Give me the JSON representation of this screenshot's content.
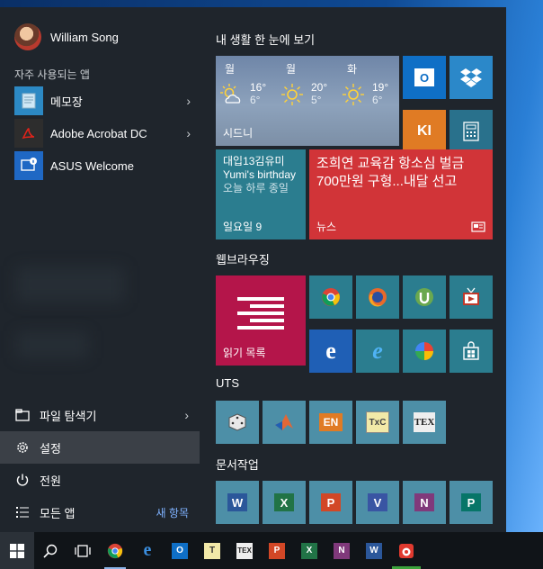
{
  "user": {
    "name": "William Song"
  },
  "frequent": {
    "label": "자주 사용되는 앱",
    "items": [
      {
        "label": "메모장",
        "has_chevron": true
      },
      {
        "label": "Adobe Acrobat DC",
        "has_chevron": true
      },
      {
        "label": "ASUS Welcome",
        "has_chevron": false
      }
    ]
  },
  "bottom": {
    "explorer": "파일 탐색기",
    "settings": "설정",
    "power": "전원",
    "all_apps": "모든 앱",
    "new_items": "새 항목"
  },
  "groups": {
    "life": "내 생활 한 눈에 보기",
    "web": "웹브라우징",
    "uts": "UTS",
    "docs": "문서작업"
  },
  "weather": {
    "city": "시드니",
    "days": [
      {
        "day": "월",
        "high": "16°",
        "low": "6°"
      },
      {
        "day": "월",
        "high": "20°",
        "low": "5°"
      },
      {
        "day": "화",
        "high": "19°",
        "low": "6°"
      }
    ]
  },
  "calendar": {
    "line1": "대입13김유미",
    "line2": "Yumi's birthday",
    "line3": "오늘 하루 종일",
    "date": "일요일 9"
  },
  "news": {
    "headline": "조희연 교육감 항소심 벌금 700만원 구형...내달 선고",
    "label": "뉴스"
  },
  "reading_list": {
    "label": "읽기 목록"
  },
  "colors": {
    "start_bg": "#1f252c",
    "tile_teal": "#29718c",
    "news_red": "#d13438",
    "reading_red": "#b4154a",
    "edge_blue": "#1f5fb5",
    "link": "#7fb2ff"
  }
}
